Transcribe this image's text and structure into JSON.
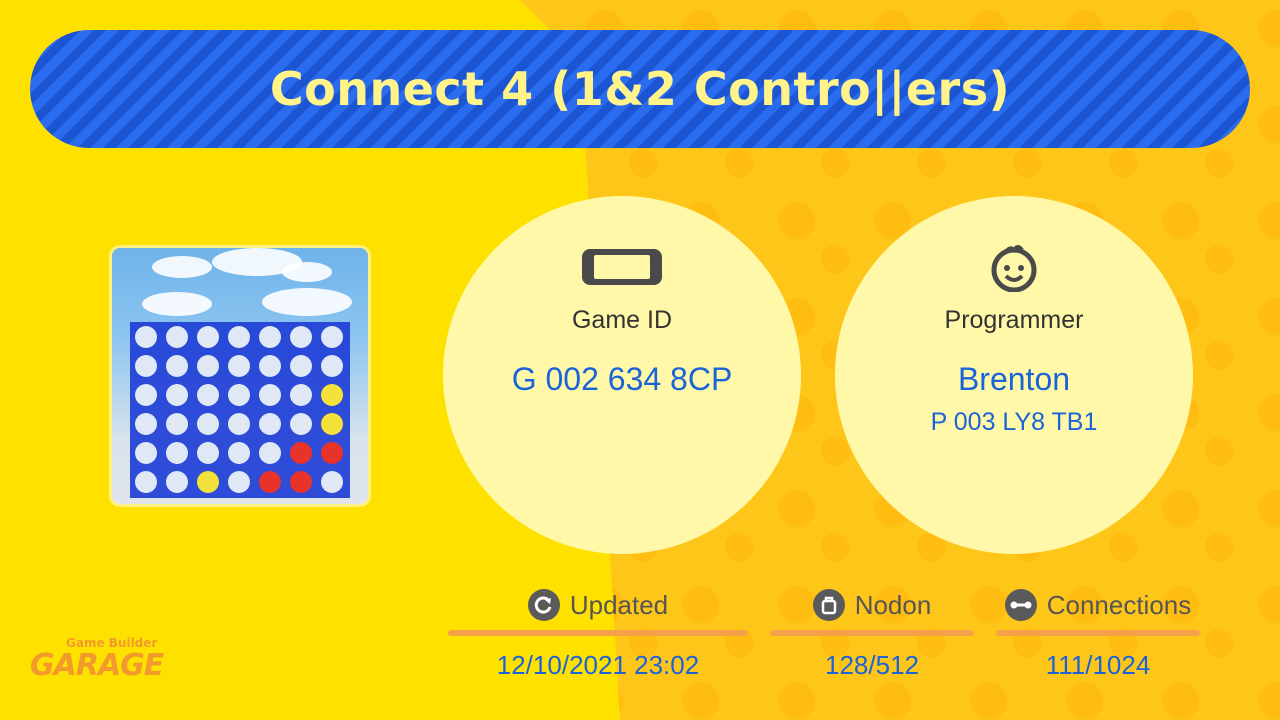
{
  "title": "Connect 4 (1&2 Contro||ers)",
  "game_id": {
    "label": "Game ID",
    "value": "G 002 634 8CP",
    "icon": "switch-console-icon"
  },
  "programmer": {
    "label": "Programmer",
    "name": "Brenton",
    "id": "P 003 LY8 TB1",
    "icon": "face-icon"
  },
  "stats": {
    "updated": {
      "label": "Updated",
      "value": "12/10/2021 23:02",
      "icon": "refresh-icon"
    },
    "nodon": {
      "label": "Nodon",
      "value": "128/512",
      "icon": "nodon-bag-icon"
    },
    "connections": {
      "label": "Connections",
      "value": "111/1024",
      "icon": "connection-icon"
    }
  },
  "logo": {
    "line1": "Game Builder",
    "line2": "GARAGE"
  },
  "colors": {
    "accent_blue": "#1a63d8",
    "title_bar": "#1f5fe0",
    "title_text": "#fff38a",
    "circle_bg": "#fff8a8",
    "rule_orange": "#f7a04a",
    "background": "#ffe100"
  }
}
